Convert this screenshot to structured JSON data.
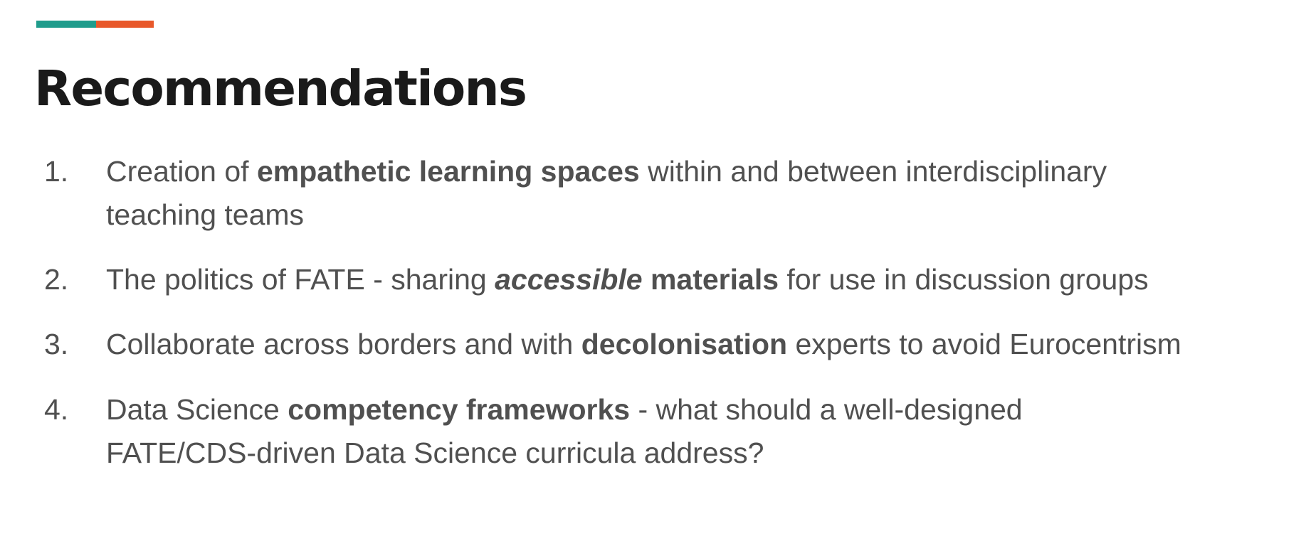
{
  "slide": {
    "title": "Recommendations",
    "accent_colors": [
      "#1f9c8c",
      "#e8582a"
    ]
  },
  "recommendations": [
    {
      "number": "1.",
      "line1": [
        {
          "text": "Creation of ",
          "style": "normal"
        },
        {
          "text": "empathetic learning spaces",
          "style": "bold"
        },
        {
          "text": " within and between interdisciplinary",
          "style": "normal"
        }
      ],
      "line2": [
        {
          "text": "teaching teams",
          "style": "normal"
        }
      ]
    },
    {
      "number": "2.",
      "line1": [
        {
          "text": "The politics of FATE - sharing ",
          "style": "normal"
        },
        {
          "text": "accessible",
          "style": "bold-italic"
        },
        {
          "text": " materials",
          "style": "bold"
        },
        {
          "text": " for use in discussion groups",
          "style": "normal"
        }
      ]
    },
    {
      "number": "3.",
      "line1": [
        {
          "text": "Collaborate across borders and with ",
          "style": "normal"
        },
        {
          "text": "decolonisation",
          "style": "bold"
        },
        {
          "text": " experts to avoid Eurocentrism",
          "style": "normal"
        }
      ]
    },
    {
      "number": "4.",
      "line1": [
        {
          "text": "Data Science ",
          "style": "normal"
        },
        {
          "text": "competency frameworks",
          "style": "bold"
        },
        {
          "text": " - what should a well-designed",
          "style": "normal"
        }
      ],
      "line2": [
        {
          "text": "FATE/CDS-driven Data Science curricula address?",
          "style": "normal"
        }
      ]
    }
  ]
}
